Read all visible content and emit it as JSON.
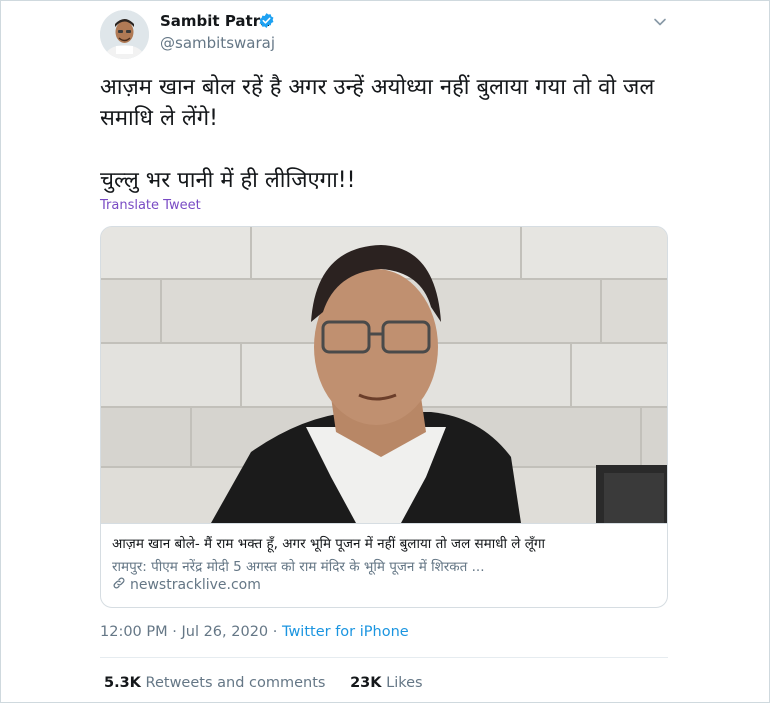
{
  "author": {
    "name": "Sambit Patra",
    "handle": "@sambitswaraj",
    "verified": true
  },
  "tweet": {
    "lines": [
      "आज़म खान बोल रहें है अगर उन्हें अयोध्या नहीं बुलाया गया तो वो जल समाधि ले लेंगे!",
      "चुल्लु भर पानी में ही लीजिएगा!!"
    ],
    "translate_label": "Translate Tweet"
  },
  "card": {
    "title": "आज़म खान बोले- मैं राम भक्त हूँ, अगर भूमि पूजन में नहीं बुलाया तो जल समाधी ले लूँगा",
    "description": "रामपुर: पीएम नरेंद्र मोदी 5 अगस्त को राम मंदिर के भूमि पूजन में शिरकत ...",
    "domain": "newstracklive.com"
  },
  "meta": {
    "time": "12:00 PM · Jul 26, 2020",
    "separator": " · ",
    "source": "Twitter for iPhone"
  },
  "stats": {
    "retweets_count": "5.3K",
    "retweets_label": "Retweets and comments",
    "likes_count": "23K",
    "likes_label": "Likes"
  },
  "colors": {
    "verified": "#1da1f2",
    "link": "#1b95e0",
    "translate": "#794bc4",
    "muted": "#657786"
  },
  "icons": [
    "verified-badge-icon",
    "chevron-down-icon",
    "link-icon"
  ]
}
